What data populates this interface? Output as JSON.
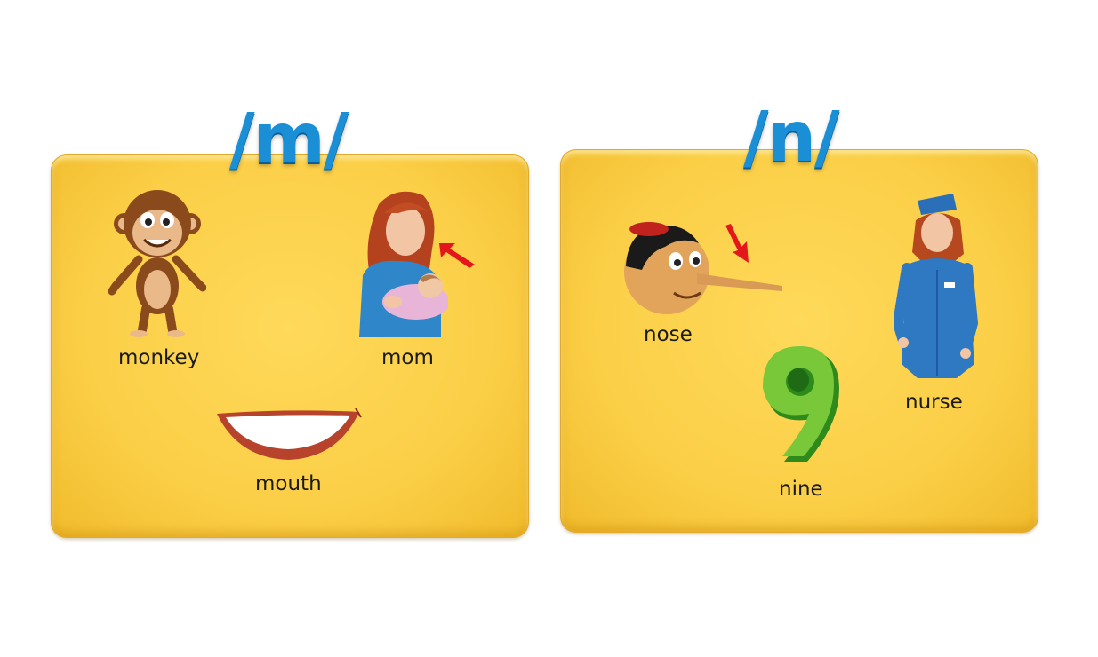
{
  "left_card": {
    "phoneme": "/m/",
    "words": {
      "monkey": "monkey",
      "mom": "mom",
      "mouth": "mouth"
    }
  },
  "right_card": {
    "phoneme": "/n/",
    "words": {
      "nose": "nose",
      "nurse": "nurse",
      "nine": "nine"
    }
  },
  "colors": {
    "card_fill": "#fbcf47",
    "phoneme_text": "#1b8fd6",
    "arrow": "#e3161b",
    "word_text": "#1a1a1a"
  },
  "icons": [
    "monkey-icon",
    "mother-with-baby-icon",
    "mouth-icon",
    "nose-boy-icon",
    "nurse-icon",
    "number-nine-icon",
    "arrow-icon"
  ]
}
